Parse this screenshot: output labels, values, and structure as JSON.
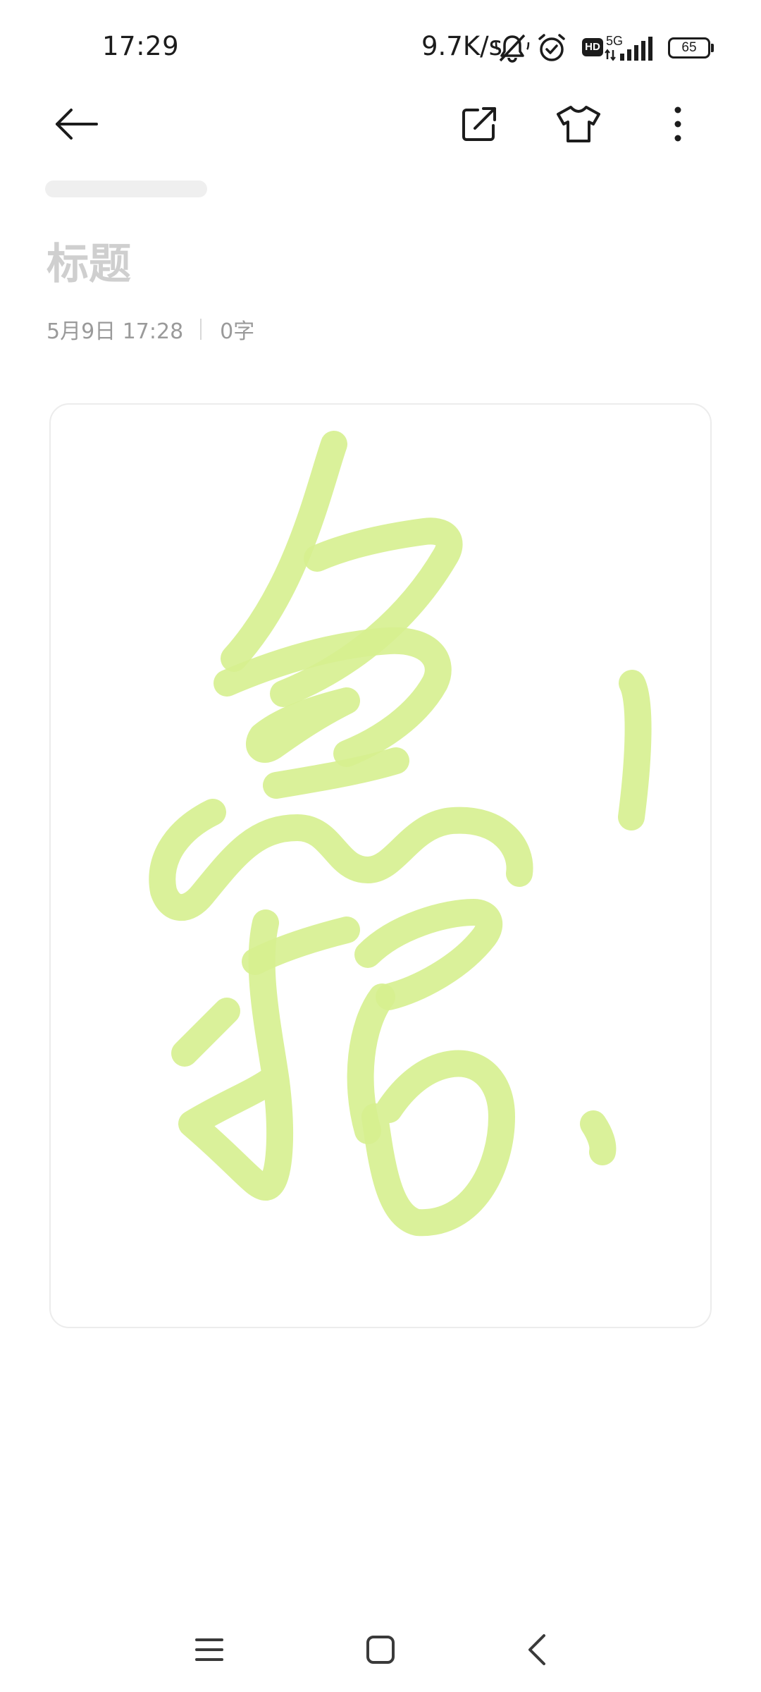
{
  "status_bar": {
    "time": "17:29",
    "net_speed": "9.7K/s",
    "hd_badge": "HD",
    "network_type": "5G",
    "battery_level": "65",
    "icons": [
      "bell-mute-icon",
      "alarm-icon",
      "hd-icon",
      "signal-5g-icon",
      "battery-icon"
    ]
  },
  "toolbar": {
    "icons": [
      "back-arrow-icon",
      "share-external-icon",
      "theme-shirt-icon",
      "more-vertical-icon"
    ]
  },
  "note": {
    "title_placeholder": "标题",
    "date": "5月9日 17:28",
    "word_count": "0字"
  },
  "drawing": {
    "stroke_color": "#d6f08f",
    "description_hidden": false
  },
  "nav_bar": {
    "icons": [
      "menu-icon",
      "home-square-icon",
      "back-chevron-icon"
    ]
  },
  "colors": {
    "background": "#ffffff",
    "text_primary": "#1c1c1c",
    "placeholder": "#cfcfcf",
    "meta_text": "#9a9a9a",
    "brush": "#d6f08f"
  }
}
